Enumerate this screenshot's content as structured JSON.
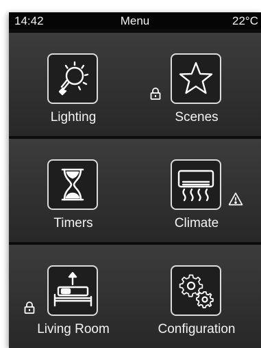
{
  "status": {
    "time": "14:42",
    "title": "Menu",
    "temperature": "22°C"
  },
  "tiles": [
    {
      "label": "Lighting",
      "icon": "bulb-icon",
      "badge": null
    },
    {
      "label": "Scenes",
      "icon": "star-icon",
      "badge": "lock-icon"
    },
    {
      "label": "Timers",
      "icon": "hourglass-icon",
      "badge": null
    },
    {
      "label": "Climate",
      "icon": "air-conditioner-icon",
      "badge": "warning-icon"
    },
    {
      "label": "Living Room",
      "icon": "bed-icon",
      "badge": "lock-icon"
    },
    {
      "label": "Configuration",
      "icon": "gears-icon",
      "badge": null
    }
  ],
  "colors": {
    "background": "#0d0d0d",
    "row_top": "#3c3c3c",
    "row_bottom": "#282828",
    "icon_stroke": "#dcdcdc",
    "text": "#f4f4f4"
  }
}
